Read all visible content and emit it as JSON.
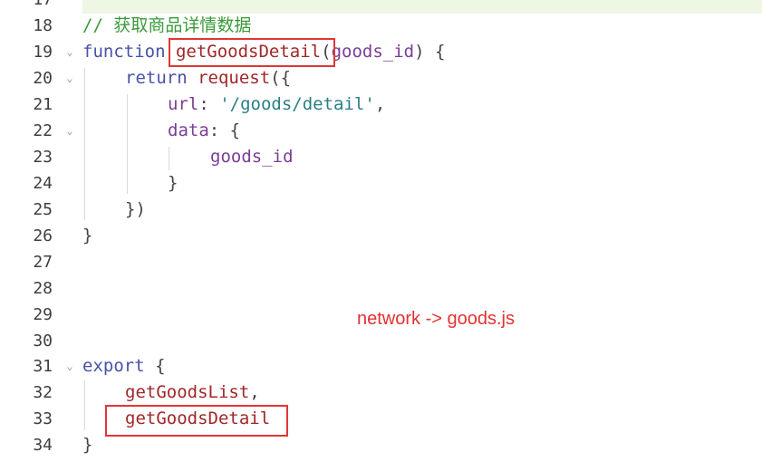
{
  "lines": [
    {
      "num": "17"
    },
    {
      "num": "18",
      "comment": "// 获取商品详情数据"
    },
    {
      "num": "19",
      "kw": "function",
      "fn": "getGoodsDetail",
      "p1": "(",
      "param": "goods_id",
      "p2": ") {"
    },
    {
      "num": "20",
      "kw": "return",
      "fn": "request",
      "p1": "({"
    },
    {
      "num": "21",
      "prop": "url",
      "p1": ": ",
      "str": "'/goods/detail'",
      "p2": ","
    },
    {
      "num": "22",
      "prop": "data",
      "p1": ": {"
    },
    {
      "num": "23",
      "var": "goods_id"
    },
    {
      "num": "24",
      "p1": "}"
    },
    {
      "num": "25",
      "p1": "})"
    },
    {
      "num": "26",
      "p1": "}"
    },
    {
      "num": "27"
    },
    {
      "num": "28"
    },
    {
      "num": "29"
    },
    {
      "num": "30"
    },
    {
      "num": "31",
      "kw": "export",
      "p1": " {"
    },
    {
      "num": "32",
      "fn": "getGoodsList",
      "p1": ","
    },
    {
      "num": "33",
      "fn": "getGoodsDetail"
    },
    {
      "num": "34",
      "p1": "}"
    }
  ],
  "annotation": "network -> goods.js",
  "colors": {
    "highlight_box": "#e03636",
    "annotation_text": "#e33232"
  }
}
